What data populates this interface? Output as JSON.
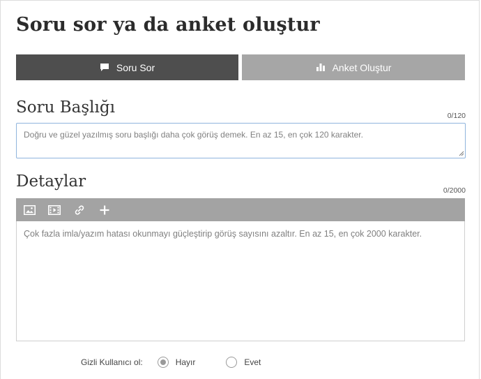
{
  "page_title": "Soru sor ya da anket oluştur",
  "tabs": [
    {
      "label": "Soru Sor",
      "icon": "speech-bubble-icon",
      "active": true
    },
    {
      "label": "Anket Oluştur",
      "icon": "bar-chart-icon",
      "active": false
    }
  ],
  "question_title": {
    "heading": "Soru Başlığı",
    "counter": "0/120",
    "value": "",
    "placeholder": "Doğru ve güzel yazılmış soru başlığı daha çok görüş demek. En az 15, en çok 120 karakter."
  },
  "details": {
    "heading": "Detaylar",
    "counter": "0/2000",
    "value": "",
    "placeholder": "Çok fazla imla/yazım hatası okunmayı güçleştirip görüş sayısını azaltır. En az 15, en çok 2000 karakter.",
    "toolbar": [
      "image-icon",
      "video-icon",
      "link-icon",
      "plus-icon"
    ]
  },
  "anonymous": {
    "label": "Gizli Kullanıcı ol:",
    "options": [
      {
        "label": "Hayır",
        "selected": true
      },
      {
        "label": "Evet",
        "selected": false
      }
    ]
  },
  "colors": {
    "active_tab": "#4e4e4e",
    "inactive_tab": "#a6a6a6",
    "toolbar": "#a3a3a3",
    "focus_border": "#8fb4dd"
  }
}
